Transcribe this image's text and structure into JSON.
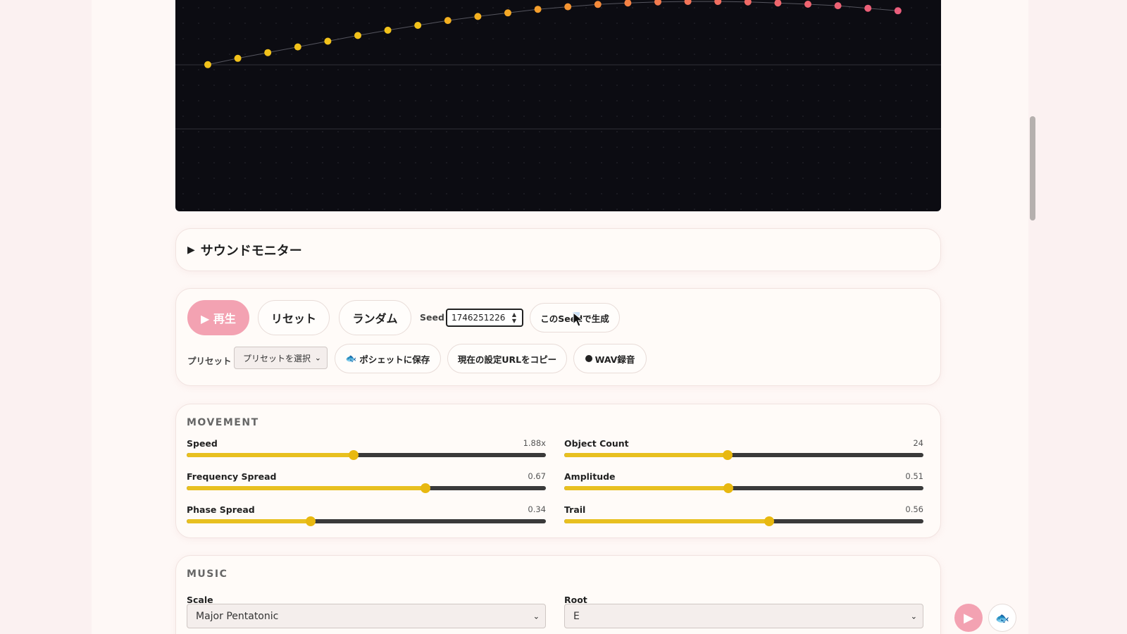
{
  "visualizer": {
    "dots": [
      {
        "x": 0,
        "y": 0.306,
        "color": "#f2c21b"
      },
      {
        "x": 1,
        "y": 0.276,
        "color": "#f2c21b"
      },
      {
        "x": 2,
        "y": 0.249,
        "color": "#f2c21b"
      },
      {
        "x": 3,
        "y": 0.222,
        "color": "#f2c21b"
      },
      {
        "x": 4,
        "y": 0.195,
        "color": "#f2c21b"
      },
      {
        "x": 5,
        "y": 0.168,
        "color": "#f2c21b"
      },
      {
        "x": 6,
        "y": 0.143,
        "color": "#f2c21b"
      },
      {
        "x": 7,
        "y": 0.12,
        "color": "#f2c21b"
      },
      {
        "x": 8,
        "y": 0.097,
        "color": "#f4b020"
      },
      {
        "x": 9,
        "y": 0.078,
        "color": "#f4b020"
      },
      {
        "x": 10,
        "y": 0.061,
        "color": "#f4a826"
      },
      {
        "x": 11,
        "y": 0.044,
        "color": "#f49e2c"
      },
      {
        "x": 12,
        "y": 0.032,
        "color": "#f49432"
      },
      {
        "x": 13,
        "y": 0.021,
        "color": "#f48a3a"
      },
      {
        "x": 14,
        "y": 0.014,
        "color": "#f48244"
      },
      {
        "x": 15,
        "y": 0.009,
        "color": "#f27a4e"
      },
      {
        "x": 16,
        "y": 0.007,
        "color": "#f27458"
      },
      {
        "x": 17,
        "y": 0.007,
        "color": "#f06e60"
      },
      {
        "x": 18,
        "y": 0.009,
        "color": "#f06a66"
      },
      {
        "x": 19,
        "y": 0.014,
        "color": "#ee666c"
      },
      {
        "x": 20,
        "y": 0.02,
        "color": "#ee6470"
      },
      {
        "x": 21,
        "y": 0.027,
        "color": "#ec6274"
      },
      {
        "x": 22,
        "y": 0.039,
        "color": "#ec6078"
      },
      {
        "x": 23,
        "y": 0.051,
        "color": "#ea5e7c"
      }
    ]
  },
  "monitor": {
    "toggle_icon": "▶",
    "title": "サウンドモニター"
  },
  "controls": {
    "play_label": "▶ 再生",
    "reset_label": "リセット",
    "random_label": "ランダム",
    "seed_label": "Seed",
    "seed_value": "1746251226",
    "generate_label": "このSeedで生成",
    "preset_label": "プリセット",
    "preset_select_value": "プリセットを選択",
    "save_pocket_label": "ポシェットに保存",
    "copy_url_label": "現在の設定URLをコピー",
    "wav_record_label": "WAV録音"
  },
  "movement": {
    "title": "MOVEMENT",
    "params": [
      {
        "name": "Speed",
        "value_text": "1.88x",
        "fraction": 0.465
      },
      {
        "name": "Object Count",
        "value_text": "24",
        "fraction": 0.455
      },
      {
        "name": "Frequency Spread",
        "value_text": "0.67",
        "fraction": 0.665
      },
      {
        "name": "Amplitude",
        "value_text": "0.51",
        "fraction": 0.457
      },
      {
        "name": "Phase Spread",
        "value_text": "0.34",
        "fraction": 0.345
      },
      {
        "name": "Trail",
        "value_text": "0.56",
        "fraction": 0.57
      }
    ]
  },
  "music": {
    "title": "MUSIC",
    "scale_label": "Scale",
    "scale_value": "Major Pentatonic",
    "root_label": "Root",
    "root_value": "E"
  },
  "colors": {
    "accent_pink": "#f3a2b2",
    "slider_yellow": "#e8c020",
    "canvas_bg": "#0c0c12"
  },
  "icons": {
    "fish": "fish-icon",
    "record": "record-dot-icon",
    "play": "play-icon",
    "chevron": "chevron-down-icon"
  }
}
